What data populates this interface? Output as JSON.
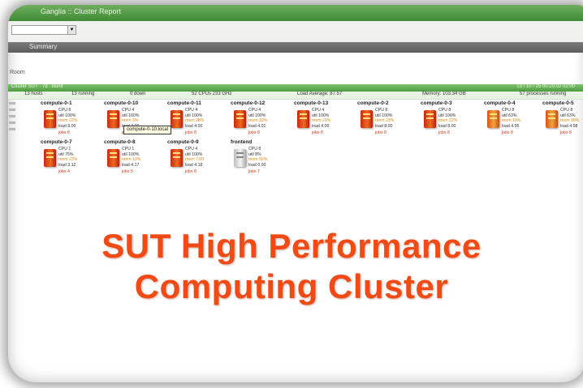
{
  "window": {
    "title": "Ganglia :: Cluster Report"
  },
  "toolbar": {
    "select_value": ""
  },
  "summary_bar": {
    "label": "Summary"
  },
  "room": {
    "label": "Room"
  },
  "status": {
    "left": "Cluster SUT · 7d · Bunit",
    "right": "13 / 10 / 25 00:20:02 02:00"
  },
  "stats": {
    "hosts_total": "13 hosts",
    "running": "13 running",
    "down": "0 down",
    "cpus": "52 CPUs 233 GHz",
    "load": "Load Average: 87.57",
    "memory": "Memory: 103.34 GB",
    "processes": "57 processes running"
  },
  "nodes": [
    {
      "name": "compute-0-1",
      "cpu": "CPU 8",
      "util": "util 100%",
      "mem": "mem 22%",
      "load": "load 8.00",
      "jobs": "jobs 8",
      "icon": "server-red"
    },
    {
      "name": "compute-0-10",
      "cpu": "CPU 4",
      "util": "util 100%",
      "mem": "mem 3%",
      "load": "load 4.00",
      "jobs": "jobs 8",
      "icon": "server-red"
    },
    {
      "name": "compute-0-11",
      "cpu": "CPU 4",
      "util": "util 100%",
      "mem": "mem 28%",
      "load": "load 4.00",
      "jobs": "jobs 8",
      "icon": "server-red"
    },
    {
      "name": "compute-0-12",
      "cpu": "CPU 4",
      "util": "util 100%",
      "mem": "mem 32%",
      "load": "load 4.01",
      "jobs": "jobs 8",
      "icon": "server-red"
    },
    {
      "name": "compute-0-13",
      "cpu": "CPU 4",
      "util": "util 100%",
      "mem": "mem 21%",
      "load": "load 4.00",
      "jobs": "jobs 8",
      "icon": "server-red"
    },
    {
      "name": "compute-0-2",
      "cpu": "CPU 8",
      "util": "util 100%",
      "mem": "mem 23%",
      "load": "load 8.00",
      "jobs": "jobs 8",
      "icon": "server-red"
    },
    {
      "name": "compute-0-3",
      "cpu": "CPU 8",
      "util": "util 100%",
      "mem": "mem 22%",
      "load": "load 8.00",
      "jobs": "jobs 8",
      "icon": "server-red"
    },
    {
      "name": "compute-0-4",
      "cpu": "CPU 8",
      "util": "util 63%",
      "mem": "mem 19%",
      "load": "load 4.95",
      "jobs": "jobs 8",
      "icon": "server-orange"
    },
    {
      "name": "compute-0-5",
      "cpu": "CPU 8",
      "util": "util 63%",
      "mem": "mem 19%",
      "load": "load 4.98",
      "jobs": "jobs 8",
      "icon": "server-orange"
    },
    {
      "name": "compute-0-7",
      "cpu": "CPU 1",
      "util": "util 75%",
      "mem": "mem 23%",
      "load": "load 3.12",
      "jobs": "jobs 4",
      "icon": "server-red"
    },
    {
      "name": "compute-0-8",
      "cpu": "CPU 1",
      "util": "util 100%",
      "mem": "mem 13%",
      "load": "load 4.17",
      "jobs": "jobs 5",
      "icon": "server-red"
    },
    {
      "name": "compute-0-9",
      "cpu": "CPU 4",
      "util": "util 100%",
      "mem": "mem 7.00",
      "load": "load 4.18",
      "jobs": "jobs 8",
      "icon": "server-red"
    },
    {
      "name": "frontend",
      "cpu": "CPU 8",
      "util": "util 8%",
      "mem": "mem 56%",
      "load": "load 0.00",
      "jobs": "jobs 7",
      "icon": "server-gray"
    }
  ],
  "tooltip": {
    "text": "compute-0-10.local"
  },
  "headline": {
    "line1": "SUT High Performance",
    "line2": "Computing Cluster"
  },
  "colors": {
    "headline": "#f24a14",
    "titlebar": "#4f9c42",
    "server_hot": "#e5421a",
    "server_warm": "#f29a3a"
  }
}
